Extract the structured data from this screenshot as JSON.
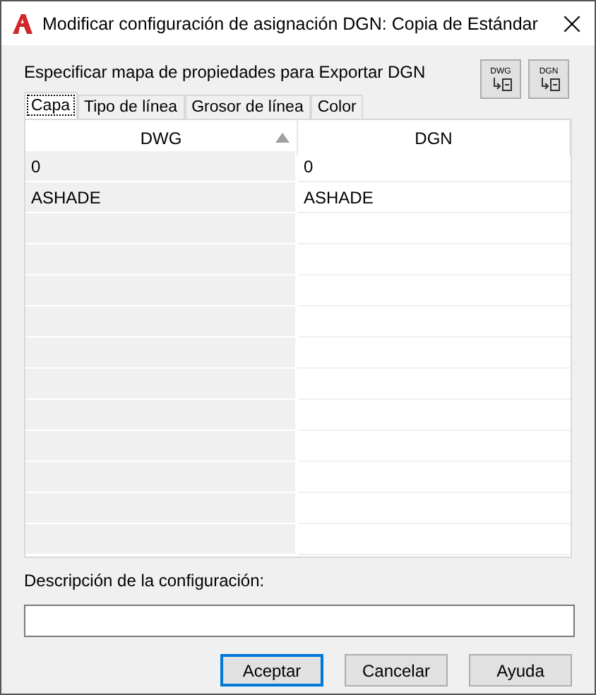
{
  "window": {
    "title": "Modificar configuración de asignación DGN: Copia de Estándar"
  },
  "heading": "Especificar mapa de propiedades para Exportar DGN",
  "icon_buttons": [
    {
      "label": "DWG"
    },
    {
      "label": "DGN"
    }
  ],
  "tabs": [
    {
      "label": "Capa",
      "selected": true
    },
    {
      "label": "Tipo de línea",
      "selected": false
    },
    {
      "label": "Grosor de línea",
      "selected": false
    },
    {
      "label": "Color",
      "selected": false
    }
  ],
  "table": {
    "columns": [
      {
        "label": "DWG",
        "sorted": true
      },
      {
        "label": "DGN",
        "sorted": false
      }
    ],
    "rows": [
      [
        "0",
        "0"
      ],
      [
        "ASHADE",
        "ASHADE"
      ]
    ]
  },
  "description": {
    "label": "Descripción de la configuración:"
  },
  "buttons": [
    {
      "label": "Aceptar",
      "default": true
    },
    {
      "label": "Cancelar",
      "default": false
    },
    {
      "label": "Ayuda",
      "default": false
    }
  ]
}
